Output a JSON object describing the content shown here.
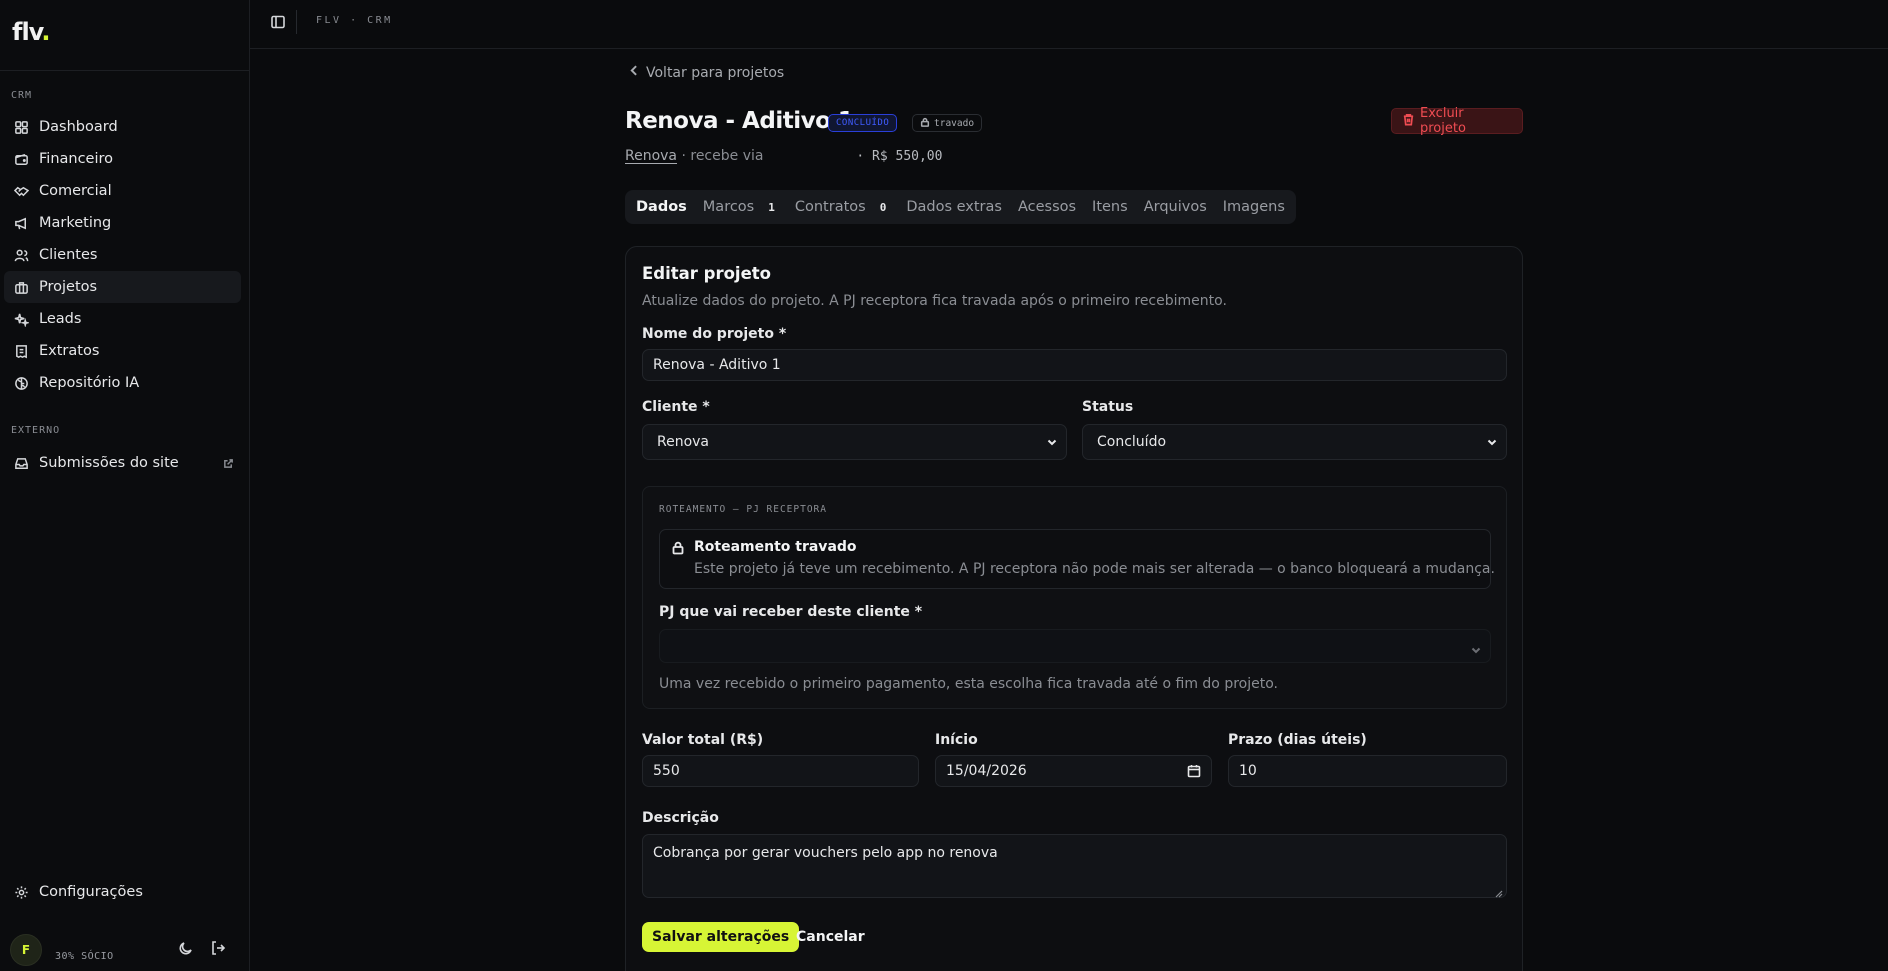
{
  "sidebar": {
    "logo_text": "flv",
    "logo_dot": ".",
    "section_crm": "CRM",
    "items": [
      {
        "label": "Dashboard",
        "icon": "layout-grid-icon"
      },
      {
        "label": "Financeiro",
        "icon": "wallet-icon"
      },
      {
        "label": "Comercial",
        "icon": "handshake-icon"
      },
      {
        "label": "Marketing",
        "icon": "megaphone-icon"
      },
      {
        "label": "Clientes",
        "icon": "users-icon"
      },
      {
        "label": "Projetos",
        "icon": "briefcase-icon",
        "active": true
      },
      {
        "label": "Leads",
        "icon": "sparkles-icon"
      },
      {
        "label": "Extratos",
        "icon": "receipt-icon"
      },
      {
        "label": "Repositório IA",
        "icon": "brain-icon"
      }
    ],
    "section_external": "EXTERNO",
    "external_items": [
      {
        "label": "Submissões do site",
        "icon": "inbox-icon"
      }
    ],
    "settings_label": "Configurações",
    "user": {
      "initial": "F",
      "role": "30% SÓCIO"
    }
  },
  "topbar": {
    "breadcrumb": "FLV · CRM"
  },
  "project": {
    "back_label": "Voltar para projetos",
    "title": "Renova - Aditivo 1",
    "status_badge": "CONCLUÍDO",
    "lock_badge": "travado",
    "delete_label": "Excluir projeto",
    "client_link": "Renova",
    "receive_text": "· recebe via",
    "amount": "· R$ 550,00"
  },
  "tabs": [
    {
      "label": "Dados",
      "active": true
    },
    {
      "label": "Marcos",
      "count": "1"
    },
    {
      "label": "Contratos",
      "count": "0"
    },
    {
      "label": "Dados extras"
    },
    {
      "label": "Acessos"
    },
    {
      "label": "Itens"
    },
    {
      "label": "Arquivos"
    },
    {
      "label": "Imagens"
    }
  ],
  "form": {
    "title": "Editar projeto",
    "description": "Atualize dados do projeto. A PJ receptora fica travada após o primeiro recebimento.",
    "name_label": "Nome do projeto *",
    "name_value": "Renova - Aditivo 1",
    "client_label": "Cliente *",
    "client_value": "Renova",
    "status_label": "Status",
    "status_value": "Concluído",
    "routing": {
      "section_label": "ROTEAMENTO — PJ RECEPTORA",
      "lock_title": "Roteamento travado",
      "lock_desc": "Este projeto já teve um recebimento. A PJ receptora não pode mais ser alterada — o banco bloqueará a mudança.",
      "pj_label": "PJ que vai receber deste cliente *",
      "pj_hint": "Uma vez recebido o primeiro pagamento, esta escolha fica travada até o fim do projeto."
    },
    "total_label": "Valor total (R$)",
    "total_value": "550",
    "start_label": "Início",
    "start_value": "15/04/2026",
    "deadline_label": "Prazo (dias úteis)",
    "deadline_value": "10",
    "desc_label": "Descrição",
    "desc_value": "Cobrança por gerar vouchers pelo app no renova",
    "save_label": "Salvar alterações",
    "cancel_label": "Cancelar"
  },
  "colors": {
    "accent": "#d7f535",
    "danger": "#ef4c52",
    "status_blue": "#3f5bff",
    "background": "#0a0b0d"
  }
}
